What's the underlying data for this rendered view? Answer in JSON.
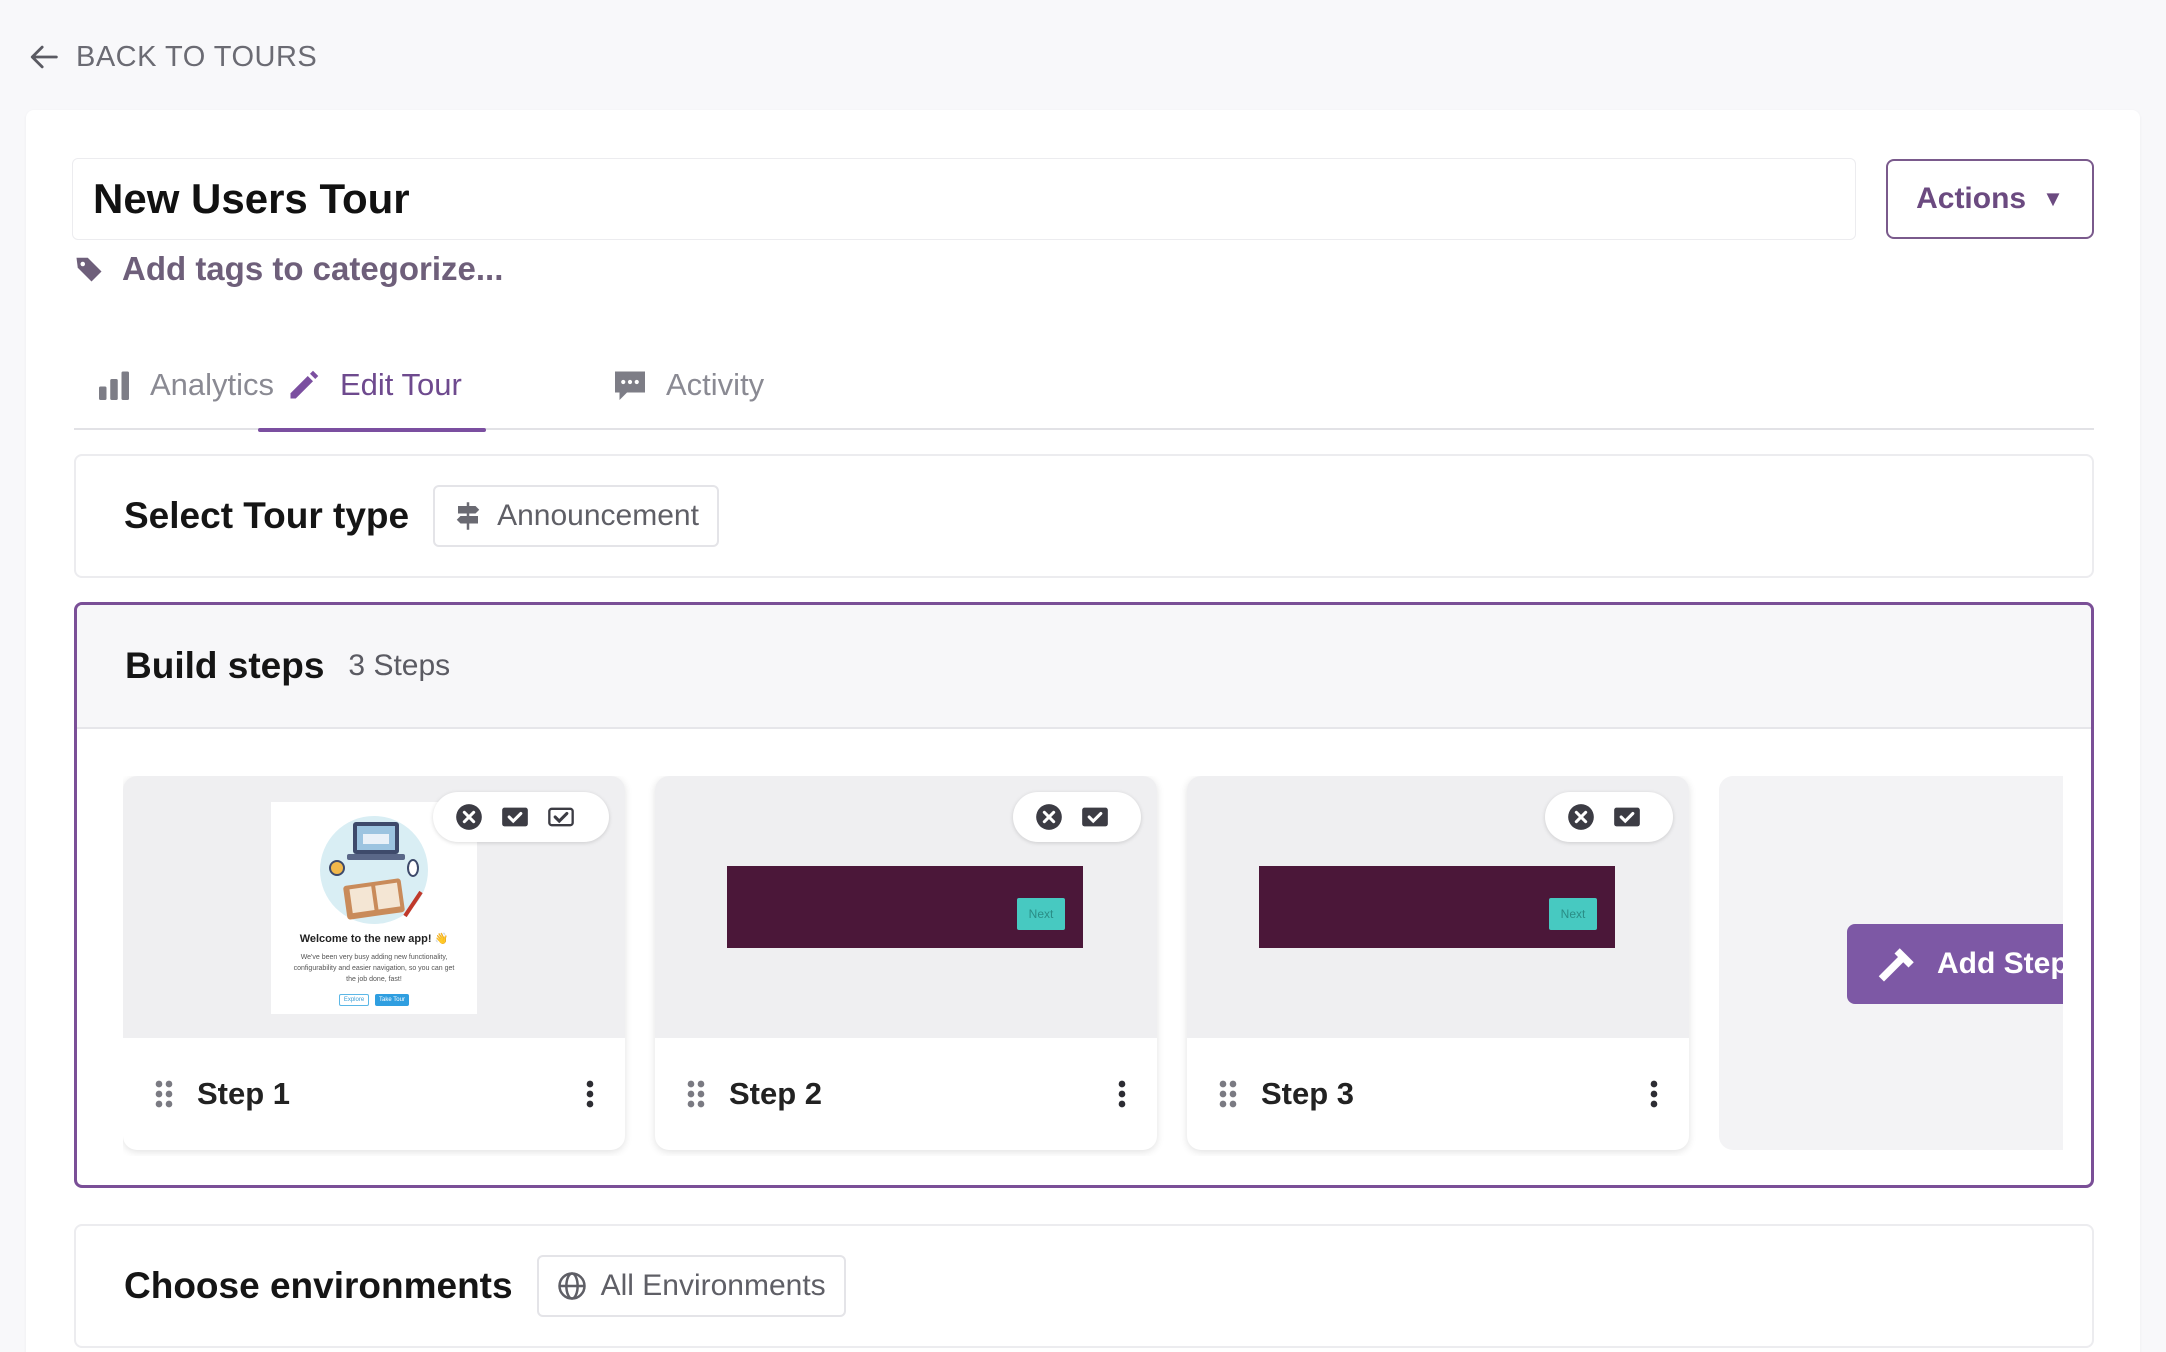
{
  "nav": {
    "back_label": "BACK TO TOURS"
  },
  "tour": {
    "title": "New Users Tour",
    "tags_placeholder": "Add tags to categorize...",
    "actions_label": "Actions",
    "actions_caret": "▼"
  },
  "tabs": [
    {
      "label": "Analytics",
      "icon": "bar-chart-icon",
      "active": false
    },
    {
      "label": "Edit Tour",
      "icon": "pencil-icon",
      "active": true
    },
    {
      "label": "Activity",
      "icon": "comment-icon",
      "active": false
    }
  ],
  "tour_type": {
    "heading": "Select Tour type",
    "value": "Announcement",
    "icon": "signpost-icon"
  },
  "build": {
    "heading": "Build steps",
    "count_label": "3 Steps",
    "steps": [
      {
        "label": "Step 1",
        "preview": {
          "title": "Welcome to the new app! 👋",
          "text": "We've been very busy adding new functionality, configurability and easier navigation, so you can get the job done, fast!",
          "buttons": [
            "Explore",
            "Take Tour"
          ]
        }
      },
      {
        "label": "Step 2",
        "preview": {
          "button": "Next"
        }
      },
      {
        "label": "Step 3",
        "preview": {
          "button": "Next"
        }
      }
    ],
    "add_step_label": "Add Step"
  },
  "environments": {
    "heading": "Choose environments",
    "value": "All Environments",
    "icon": "globe-icon"
  },
  "colors": {
    "accent": "#7b4fa0",
    "step_bar": "#4b1739",
    "next_button": "#47c9c1",
    "add_button": "#7d58a5"
  }
}
